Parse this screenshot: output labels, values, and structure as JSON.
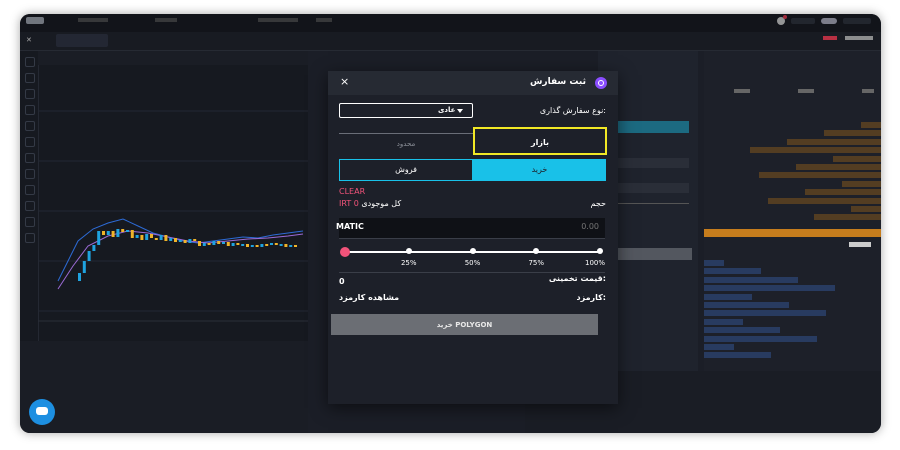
{
  "modal": {
    "title": "ثبت سفارش",
    "close": "×",
    "order_type_label": "نوع سفارش گذاری:",
    "order_type_value": "عادی",
    "tab_market": "بازار",
    "tab_limit": "محدود",
    "tab_buy": "خرید",
    "tab_sell": "فروش",
    "clear": "CLEAR",
    "available_label": "کل موجودی",
    "available_amount": "IRT 0",
    "volume_label": "حجم",
    "volume_unit": "MATIC",
    "volume_placeholder": "0.00",
    "slider_ticks": [
      "25%",
      "50%",
      "75%",
      "100%"
    ],
    "slider_value_fraction": 0,
    "estimated_label": "قیمت تخمینی:",
    "estimated_value": "0",
    "fee_label": "کارمزد:",
    "fee_link": "مشاهده کارمزد",
    "submit_label": "خرید POLYGON"
  },
  "colors": {
    "accent_cyan": "#19c1e8",
    "highlight_yellow": "#f2e825",
    "pink": "#f2537a",
    "panel_bg": "#1d2029"
  },
  "icons": {
    "close": "close-icon",
    "logo": "polygon-logo-icon",
    "caret": "caret-down-icon",
    "chat": "chat-icon"
  }
}
